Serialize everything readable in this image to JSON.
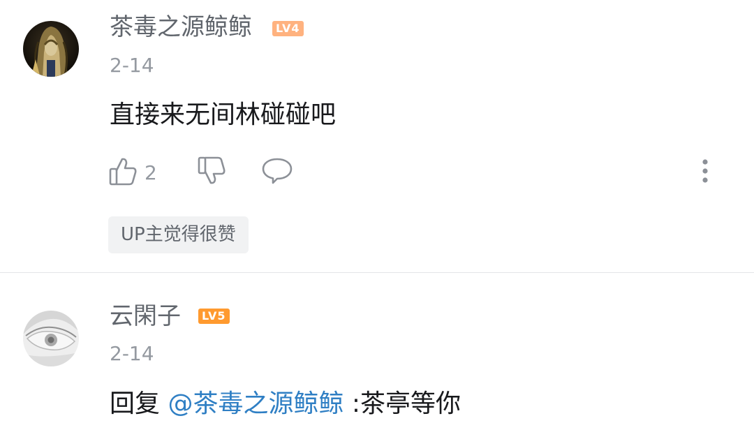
{
  "comments": [
    {
      "username": "茶毒之源鲸鲸",
      "level": "LV4",
      "date": "2-14",
      "content": "直接来无间林碰碰吧",
      "like_count": "2",
      "up_tag": "UP主觉得很赞",
      "level_color": "#ffb27f"
    },
    {
      "username": "云閑子",
      "level": "LV5",
      "date": "2-14",
      "reply_prefix": "回复 ",
      "mention": "@茶毒之源鲸鲸",
      "content": " :茶亭等你",
      "level_color": "#ff9a2f"
    }
  ],
  "icons": {
    "like": "thumbs-up-icon",
    "dislike": "thumbs-down-icon",
    "reply": "comment-bubble-icon",
    "more": "vertical-dots-icon"
  },
  "colors": {
    "username": "#61666d",
    "meta": "#9499a0",
    "text": "#18191c",
    "mention": "#2f7fc4",
    "divider": "#e3e5e7"
  }
}
